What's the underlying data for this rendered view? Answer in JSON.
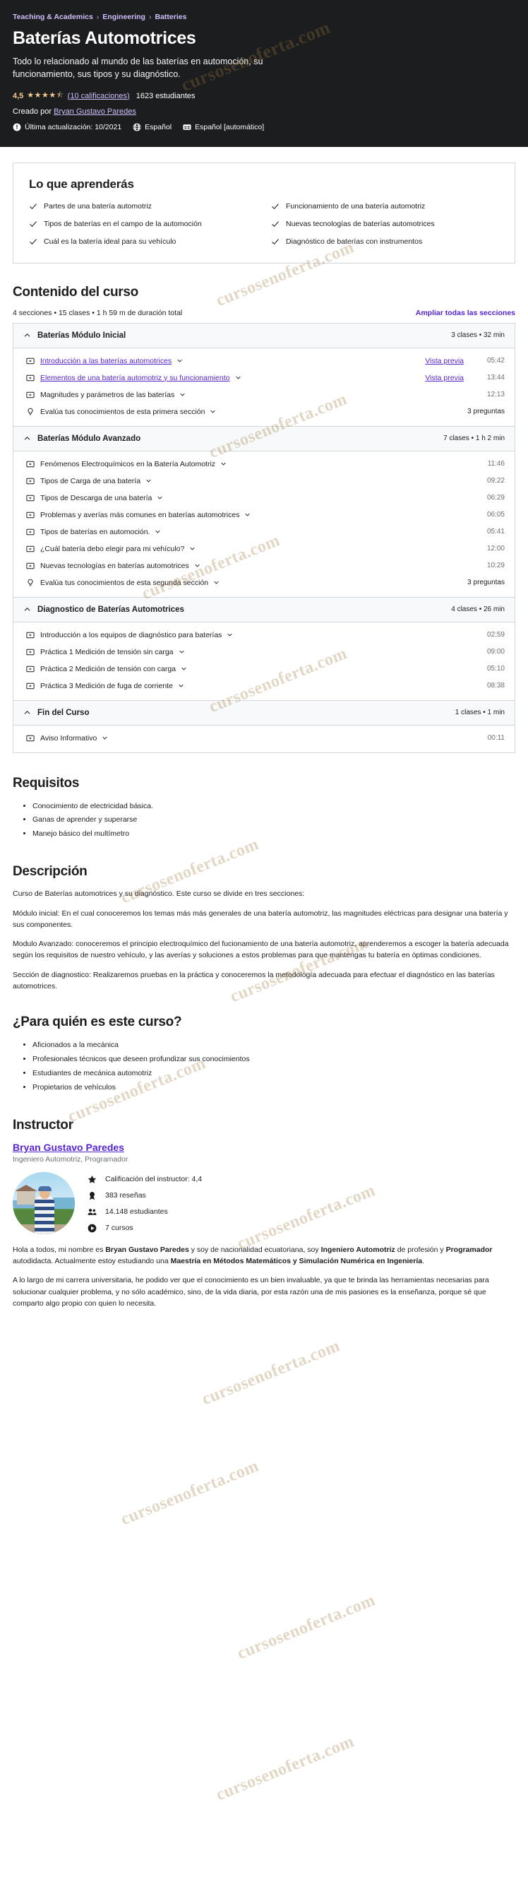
{
  "hero": {
    "breadcrumbs": [
      "Teaching & Academics",
      "Engineering",
      "Batteries"
    ],
    "title": "Baterías Automotrices",
    "subtitle": "Todo lo relacionado al mundo de las baterías en automoción, su funcionamiento, sus tipos y su diagnóstico.",
    "rating_value": "4,5",
    "stars": "★★★★",
    "half_star": "⯨",
    "ratings_count": "(10 calificaciones)",
    "students": "1623 estudiantes",
    "created_by_label": "Creado por",
    "instructor_link": "Bryan Gustavo Paredes",
    "last_update": "Última actualización: 10/2021",
    "language": "Español",
    "captions": "Español [automático]",
    "icons": {
      "info": "info-icon",
      "globe": "globe-icon",
      "captions": "closed-captions-icon"
    }
  },
  "learn": {
    "heading": "Lo que aprenderás",
    "items": [
      "Partes de una batería automotriz",
      "Funcionamiento de una batería automotriz",
      "Tipos de baterías en el campo de la automoción",
      "Nuevas tecnologías de baterías automotrices",
      "Cuál es la batería ideal para su vehículo",
      "Diagnóstico de baterías con instrumentos"
    ]
  },
  "curriculum": {
    "heading": "Contenido del curso",
    "meta": "4 secciones • 15 clases • 1 h 59 m de duración total",
    "expand_label": "Ampliar todas las secciones",
    "sections": [
      {
        "title": "Baterías Módulo Inicial",
        "meta": "3 clases • 32 min",
        "lectures": [
          {
            "icon": "video-icon",
            "title": "Introducción a las baterías automotrices",
            "link": true,
            "preview": "Vista previa",
            "duration": "05:42"
          },
          {
            "icon": "video-icon",
            "title": "Elementos de una batería automotriz y su funcionamiento",
            "link": true,
            "preview": "Vista previa",
            "duration": "13:44"
          },
          {
            "icon": "video-icon",
            "title": "Magnitudes y parámetros de las baterías",
            "link": false,
            "preview": "",
            "duration": "12:13"
          },
          {
            "icon": "quiz-icon",
            "title": "Evalúa tus conocimientos de esta primera sección",
            "link": false,
            "preview": "",
            "duration": "3 preguntas"
          }
        ]
      },
      {
        "title": "Baterías Módulo Avanzado",
        "meta": "7 clases • 1 h 2 min",
        "lectures": [
          {
            "icon": "video-icon",
            "title": "Fenómenos Electroquímicos en la Batería Automotriz",
            "link": false,
            "preview": "",
            "duration": "11:46"
          },
          {
            "icon": "video-icon",
            "title": "Tipos de Carga de una batería",
            "link": false,
            "preview": "",
            "duration": "09:22"
          },
          {
            "icon": "video-icon",
            "title": "Tipos de Descarga de una batería",
            "link": false,
            "preview": "",
            "duration": "06:29"
          },
          {
            "icon": "video-icon",
            "title": "Problemas y averías más comunes en baterías automotrices",
            "link": false,
            "preview": "",
            "duration": "06:05"
          },
          {
            "icon": "video-icon",
            "title": "Tipos de baterías en automoción.",
            "link": false,
            "preview": "",
            "duration": "05:41"
          },
          {
            "icon": "video-icon",
            "title": "¿Cuál batería debo elegir para mi vehículo?",
            "link": false,
            "preview": "",
            "duration": "12:00"
          },
          {
            "icon": "video-icon",
            "title": "Nuevas tecnologías en baterías automotrices",
            "link": false,
            "preview": "",
            "duration": "10:29"
          },
          {
            "icon": "quiz-icon",
            "title": "Evalúa tus conocimientos de esta segunda sección",
            "link": false,
            "preview": "",
            "duration": "3 preguntas"
          }
        ]
      },
      {
        "title": "Diagnostico de Baterías Automotrices",
        "meta": "4 clases • 26 min",
        "lectures": [
          {
            "icon": "video-icon",
            "title": "Introducción a los equipos de diagnóstico para baterías",
            "link": false,
            "preview": "",
            "duration": "02:59"
          },
          {
            "icon": "video-icon",
            "title": "Práctica 1 Medición de tensión sin carga",
            "link": false,
            "preview": "",
            "duration": "09:00"
          },
          {
            "icon": "video-icon",
            "title": "Práctica 2 Medición de tensión con carga",
            "link": false,
            "preview": "",
            "duration": "05:10"
          },
          {
            "icon": "video-icon",
            "title": "Práctica 3 Medición de fuga de corriente",
            "link": false,
            "preview": "",
            "duration": "08:38"
          }
        ]
      },
      {
        "title": "Fin del Curso",
        "meta": "1 clases • 1 min",
        "lectures": [
          {
            "icon": "video-icon",
            "title": "Aviso Informativo",
            "link": false,
            "preview": "",
            "duration": "00:11"
          }
        ]
      }
    ]
  },
  "requirements": {
    "heading": "Requisitos",
    "items": [
      "Conocimiento de electricidad básica.",
      "Ganas de aprender y superarse",
      "Manejo básico del multímetro"
    ]
  },
  "description": {
    "heading": "Descripción",
    "paragraphs": [
      "Curso de Baterías automotrices y su diagnóstico. Este curso se divide en tres secciones:",
      "Módulo inicial: En el cual conoceremos los temas más más generales de una batería automotriz, las magnitudes eléctricas para designar una batería y sus componentes.",
      "Modulo Avanzado: conoceremos el principio electroquímico del fucionamiento de una batería automotriz, aprenderemos a escoger la batería adecuada según los requisitos de nuestro vehículo, y las averías y soluciones a estos problemas para que mantengas tu batería en óptimas condiciones.",
      "Sección de diagnostico: Realizaremos pruebas en la práctica y conoceremos la metodología adecuada para efectuar el diagnóstico en las baterías automotrices."
    ]
  },
  "audience": {
    "heading": "¿Para quién es este curso?",
    "items": [
      "Aficionados a la mecánica",
      "Profesionales técnicos que deseen profundizar sus conocimientos",
      "Estudiantes de mecánica automotriz",
      "Propietarios de vehículos"
    ]
  },
  "instructor": {
    "heading": "Instructor",
    "name": "Bryan Gustavo Paredes",
    "role": "Ingeniero Automotriz, Programador",
    "stats": [
      {
        "icon": "star-icon",
        "text": "Calificación del instructor: 4,4"
      },
      {
        "icon": "award-icon",
        "text": "383 reseñas"
      },
      {
        "icon": "users-icon",
        "text": "14.148 estudiantes"
      },
      {
        "icon": "play-icon",
        "text": "7 cursos"
      }
    ],
    "bio_1_pre": "Hola a todos, mi nombre es ",
    "bio_1_b1": "Bryan Gustavo Paredes",
    "bio_1_mid": " y soy de nacionalidad ecuatoriana, soy ",
    "bio_1_b2": "Ingeniero Automotriz",
    "bio_1_mid2": " de profesión y ",
    "bio_1_b3": "Programador",
    "bio_1_mid3": " autodidacta. Actualmente estoy estudiando una ",
    "bio_1_b4": "Maestría en Métodos Matemáticos y Simulación Numérica en Ingeniería",
    "bio_1_end": ".",
    "bio_2": "A lo largo de mi carrera universitaria, he podido ver que el conocimiento es un bien invaluable, ya que te brinda las herramientas necesarias para solucionar cualquier problema, y no sólo académico, sino, de la vida diaria, por esta razón una de mis pasiones es la enseñanza, porque sé que comparto algo propio con quien lo necesita."
  },
  "watermark": {
    "text": "cursosenoferta.com"
  }
}
